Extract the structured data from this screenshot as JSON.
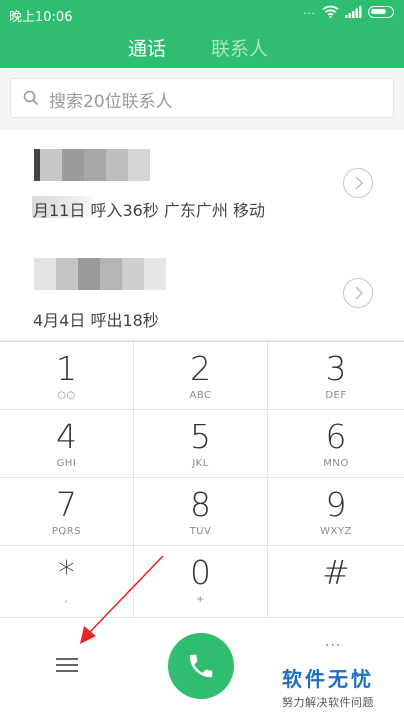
{
  "status_bar": {
    "time": "晚上10:06",
    "signal_text": "..."
  },
  "tabs": [
    {
      "label": "通话",
      "active": true
    },
    {
      "label": "联系人",
      "active": false
    }
  ],
  "search": {
    "placeholder": "搜索20位联系人"
  },
  "call_log": [
    {
      "name": "",
      "detail": "月11日 呼入36秒 广东广州 移动"
    },
    {
      "name": "",
      "detail": "4月4日 呼出18秒"
    }
  ],
  "dialpad": [
    {
      "digit": "1",
      "letters": "○○"
    },
    {
      "digit": "2",
      "letters": "ABC"
    },
    {
      "digit": "3",
      "letters": "DEF"
    },
    {
      "digit": "4",
      "letters": "GHI"
    },
    {
      "digit": "5",
      "letters": "JKL"
    },
    {
      "digit": "6",
      "letters": "MNO"
    },
    {
      "digit": "7",
      "letters": "PQRS"
    },
    {
      "digit": "8",
      "letters": "TUV"
    },
    {
      "digit": "9",
      "letters": "WXYZ"
    },
    {
      "digit": "*",
      "letters": ","
    },
    {
      "digit": "0",
      "letters": "+"
    },
    {
      "digit": "#",
      "letters": ""
    }
  ],
  "bottom_bar": {
    "more_label": "..."
  },
  "watermark": {
    "title": "软件无忧",
    "subtitle": "努力解决软件问题"
  },
  "colors": {
    "accent": "#2fbd6f",
    "watermark": "#1e6fc4",
    "arrow": "#e8262a"
  },
  "icons": [
    "search-icon",
    "info-chevron-icon",
    "menu-icon",
    "phone-icon",
    "wifi-icon",
    "signal-icon",
    "battery-icon"
  ]
}
